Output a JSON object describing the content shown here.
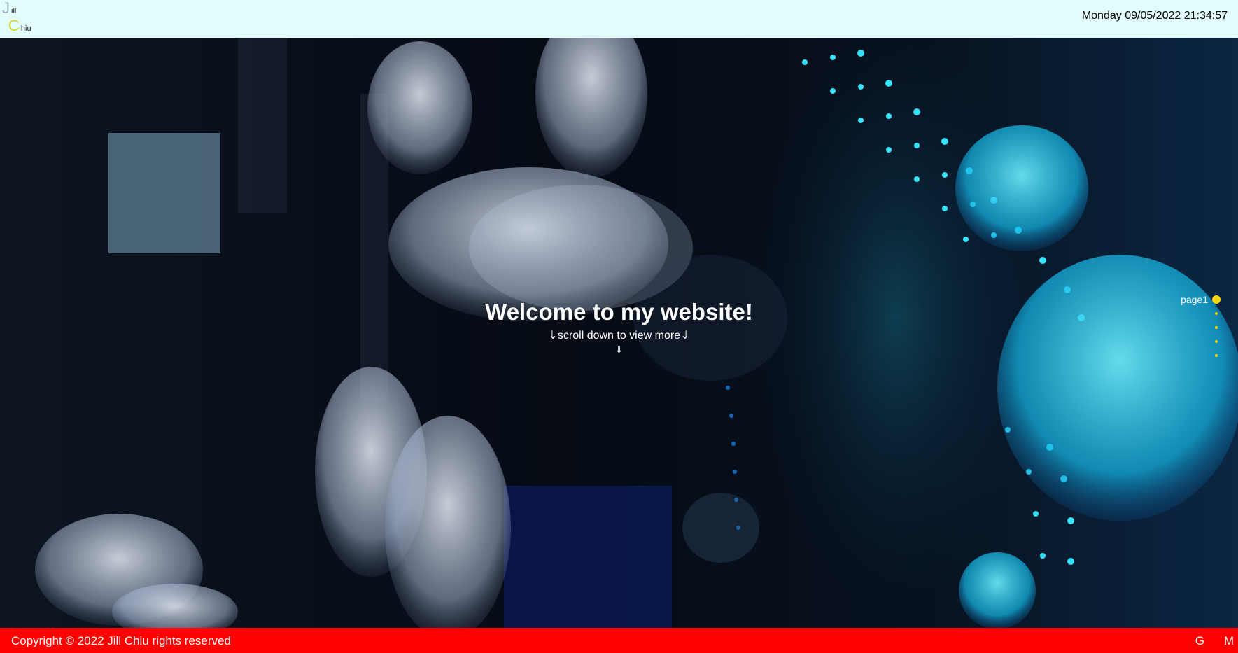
{
  "header": {
    "logo_line1_initial": "J",
    "logo_line1_rest": "ill",
    "logo_line2_initial": "C",
    "logo_line2_rest": "hiu",
    "logo_colors": {
      "line1_initial": "#9ab3c8",
      "line2_initial": "#d4d42a"
    },
    "datetime": "Monday 09/05/2022 21:34:57"
  },
  "hero": {
    "background": "jellyfish-aquarium-photo",
    "title": "Welcome to my website!",
    "subtitle": "⇓scroll down to view more⇓",
    "arrow": "⇓"
  },
  "page_nav": {
    "active_label": "page1",
    "active_color": "#f5d50b",
    "dot_count": 5
  },
  "footer": {
    "copyright": "Copyright © 2022 Jill Chiu rights reserved",
    "link_g": "G",
    "link_m": "M",
    "background": "#ff0000"
  }
}
